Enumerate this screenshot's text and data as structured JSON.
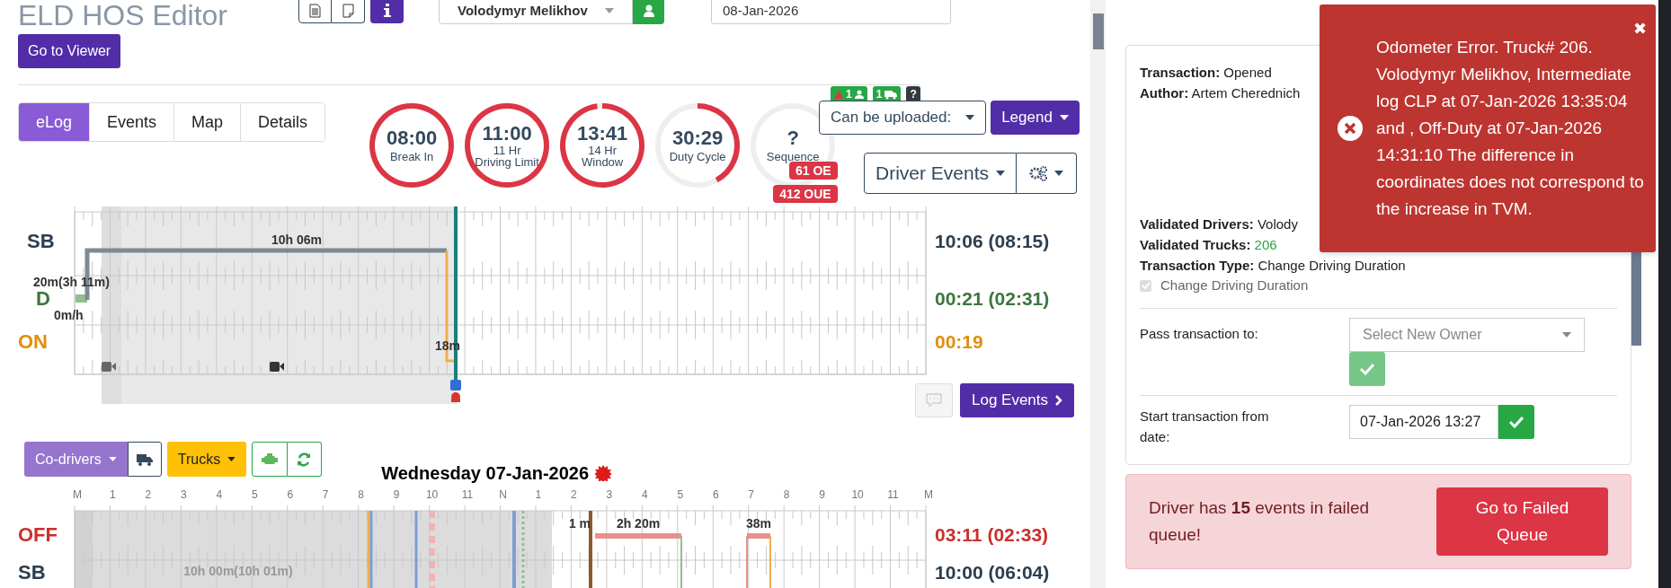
{
  "header": {
    "title": "ELD HOS Editor",
    "driver_select": {
      "value": "Volodymyr Melikhov"
    },
    "date_field": {
      "value": "08-Jan-2026"
    },
    "viewer_button": "Go to Viewer"
  },
  "tabs": [
    {
      "label": "eLog",
      "selected": true
    },
    {
      "label": "Events",
      "selected": false
    },
    {
      "label": "Map",
      "selected": false
    },
    {
      "label": "Details",
      "selected": false
    }
  ],
  "gauges": [
    {
      "value": "08:00",
      "label": "Break In",
      "level": 1
    },
    {
      "value": "11:00",
      "sublabel": "11 Hr",
      "label": "Driving Limit",
      "level": 1
    },
    {
      "value": "13:41",
      "sublabel": "14 Hr",
      "label": "Window",
      "level": 0.98
    },
    {
      "value": "30:29",
      "label": "Duty Cycle",
      "level": 0.42
    },
    {
      "value": "?",
      "label": "Sequence"
    }
  ],
  "status_badges": [
    {
      "text": "1",
      "kind": "driver"
    },
    {
      "text": "1",
      "kind": "truck"
    },
    {
      "text": "?",
      "kind": "help"
    }
  ],
  "error_badges": [
    "61 OE",
    "412 OUE"
  ],
  "upload_select": "Can be uploaded:",
  "legend_button": "Legend",
  "driver_events_select": "Driver Events",
  "log_chart": {
    "rows": [
      {
        "status": "SB",
        "total": "10:06 (08:15)",
        "color": "#2c3e50"
      },
      {
        "status": "D",
        "total": "00:21 (02:31)",
        "color": "#3c763d"
      },
      {
        "status": "ON",
        "total": "00:19",
        "color": "#e08e0b"
      }
    ],
    "segment_labels": [
      "10h 06m",
      "20m(3h 11m)",
      "0m/h",
      "18m"
    ]
  },
  "log_events_button": "Log Events",
  "toolbar": {
    "codrivers_button": "Co-drivers",
    "trucks_button": "Trucks"
  },
  "day_chart": {
    "title": "Wednesday 07-Jan-2026",
    "hours": [
      "M",
      "1",
      "2",
      "3",
      "4",
      "5",
      "6",
      "7",
      "8",
      "9",
      "10",
      "11",
      "N",
      "1",
      "2",
      "3",
      "4",
      "5",
      "6",
      "7",
      "8",
      "9",
      "10",
      "11",
      "M"
    ],
    "rows": [
      {
        "status": "OFF",
        "total": "03:11 (02:33)",
        "color": "#c9302c"
      },
      {
        "status": "SB",
        "total": "10:00 (06:04)",
        "color": "#2c3e50"
      }
    ],
    "segment_labels": [
      "1 m",
      "2h 20m",
      "38m",
      "10h 00m(10h 01m)"
    ]
  },
  "transaction": {
    "header_fields": [
      {
        "label": "Transaction:",
        "value": "Opened"
      },
      {
        "label": "Author:",
        "value": "Artem Cherednich"
      }
    ],
    "validated_fields": [
      {
        "label": "Validated Drivers:",
        "value": "Volody",
        "kind": "plain"
      },
      {
        "label": "Validated Trucks:",
        "value": "206",
        "kind": "highlight"
      },
      {
        "label": "Transaction Type:",
        "value": "Change Driving Duration",
        "kind": "plain"
      }
    ],
    "checkbox": {
      "label": "Change Driving Duration",
      "checked": true,
      "disabled": true
    },
    "pass_to": {
      "label": "Pass transaction to:",
      "placeholder": "Select New Owner",
      "confirm_disabled": true
    },
    "start_from": {
      "label": "Start transaction from date:",
      "value": "07-Jan-2026 13:27",
      "confirm_disabled": false
    }
  },
  "failed_alert": {
    "text": "Driver has **15** events in failed queue!",
    "button": "Go to Failed Queue"
  },
  "toast": {
    "text": "Odometer Error. Truck# 206. Volodymyr Melikhov, Intermediate log CLP at 07-Jan-2026 13:35:04 and , Off-Duty at 07-Jan-2026 14:31:10 The difference in coordinates does not correspond to the increase in TVM.",
    "close": "✖"
  }
}
